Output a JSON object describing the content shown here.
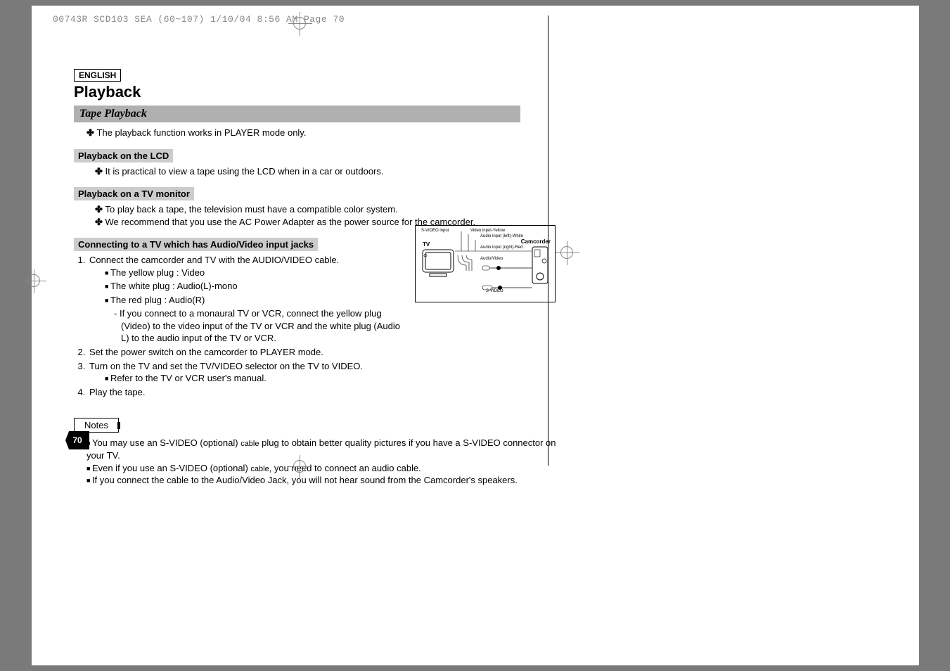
{
  "header_stamp": "00743R SCD103 SEA (60~107)  1/10/04 8:56 AM  Page 70",
  "language": "ENGLISH",
  "title": "Playback",
  "section": "Tape Playback",
  "intro": "The playback function works in PLAYER mode only.",
  "lcd": {
    "heading": "Playback on the LCD",
    "text": "It is practical to view a tape using the LCD when in a car or outdoors."
  },
  "tvmon": {
    "heading": "Playback on a TV monitor",
    "b1": "To play back a tape, the television must have a compatible color system.",
    "b2": "We recommend that you use the AC Power Adapter as the power source for the camcorder."
  },
  "connect": {
    "heading": "Connecting to a TV which has Audio/Video input jacks",
    "step1": "Connect the camcorder and TV with the AUDIO/VIDEO cable.",
    "plug_yellow": "The yellow plug : Video",
    "plug_white": "The white plug : Audio(L)-mono",
    "plug_red": "The red plug : Audio(R)",
    "mono_note": "If you connect to a monaural TV or VCR, connect the yellow plug (Video) to the video input of the TV or VCR and the white plug (Audio L) to the audio input of the TV or VCR.",
    "step2": "Set the power switch on the camcorder to PLAYER mode.",
    "step3": "Turn on the TV and set the TV/VIDEO selector on the TV to VIDEO.",
    "step3_sub": "Refer to the TV or VCR user's manual.",
    "step4": "Play the tape."
  },
  "notes_label": "Notes",
  "notes": {
    "n1_a": "You may use an S-VIDEO (optional) ",
    "n1_cable": "cable",
    "n1_b": " plug to obtain better quality pictures if you have a S-VIDEO connector on your TV.",
    "n2_a": "Even if you use an S-VIDEO (optional) ",
    "n2_cable": "cable",
    "n2_b": ", you need to connect an audio cable.",
    "n3": "If you connect the cable to the Audio/Video Jack, you will not hear sound from the Camcorder's speakers."
  },
  "page_number": "70",
  "diagram": {
    "tv": "TV",
    "camcorder": "Camcorder",
    "svideo_in": "S-VIDEO input",
    "video_in": "Video input-Yellow",
    "audio_l": "Audio input (left)-White",
    "audio_r": "Audio input (right)-Red",
    "av": "Audio/Video",
    "svideo": "S-VIDEO"
  }
}
